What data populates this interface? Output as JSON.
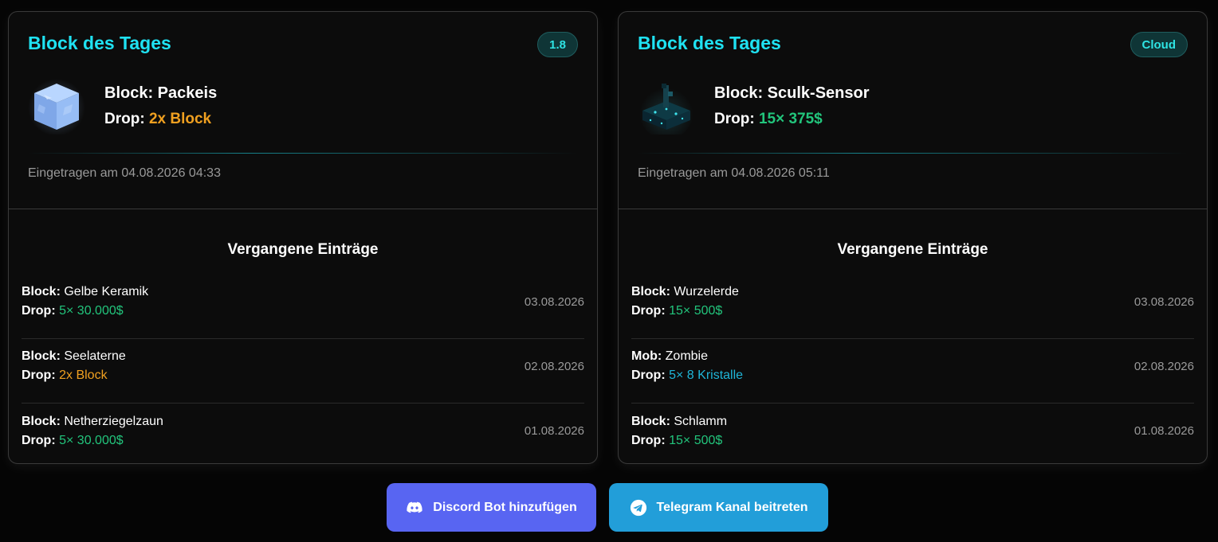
{
  "cards": [
    {
      "title": "Block des Tages",
      "badge": "1.8",
      "block_label": "Block: Packeis",
      "drop_prefix": "Drop:",
      "drop_value": "2x Block",
      "block_icon": "packed-ice-icon",
      "entered": "Eingetragen am 04.08.2026 04:33",
      "past_title": "Vergangene Einträge",
      "entries": [
        {
          "type": "Block:",
          "name": "Gelbe Keramik",
          "drop_prefix": "Drop:",
          "drop": "5× 30.000$",
          "date": "03.08.2026"
        },
        {
          "type": "Block:",
          "name": "Seelaterne",
          "drop_prefix": "Drop:",
          "drop": "2x Block",
          "date": "02.08.2026"
        },
        {
          "type": "Block:",
          "name": "Netherziegelzaun",
          "drop_prefix": "Drop:",
          "drop": "5× 30.000$",
          "date": "01.08.2026"
        }
      ]
    },
    {
      "title": "Block des Tages",
      "badge": "Cloud",
      "block_label": "Block: Sculk-Sensor",
      "drop_prefix": "Drop:",
      "drop_value": "15× 375$",
      "block_icon": "sculk-sensor-icon",
      "entered": "Eingetragen am 04.08.2026 05:11",
      "past_title": "Vergangene Einträge",
      "entries": [
        {
          "type": "Block:",
          "name": "Wurzelerde",
          "drop_prefix": "Drop:",
          "drop": "15× 500$",
          "date": "03.08.2026"
        },
        {
          "type": "Mob:",
          "name": "Zombie",
          "drop_prefix": "Drop:",
          "drop": "5× 8 Kristalle",
          "date": "02.08.2026"
        },
        {
          "type": "Block:",
          "name": "Schlamm",
          "drop_prefix": "Drop:",
          "drop": "15× 500$",
          "date": "01.08.2026"
        }
      ]
    }
  ],
  "buttons": {
    "discord": "Discord Bot hinzufügen",
    "telegram": "Telegram Kanal beitreten"
  },
  "colors": {
    "accent": "#1fe2f2",
    "orange": "#f0a020",
    "green": "#22c57c",
    "teal": "#1fb5d8",
    "discord": "#5865f2",
    "telegram": "#229ed9"
  }
}
